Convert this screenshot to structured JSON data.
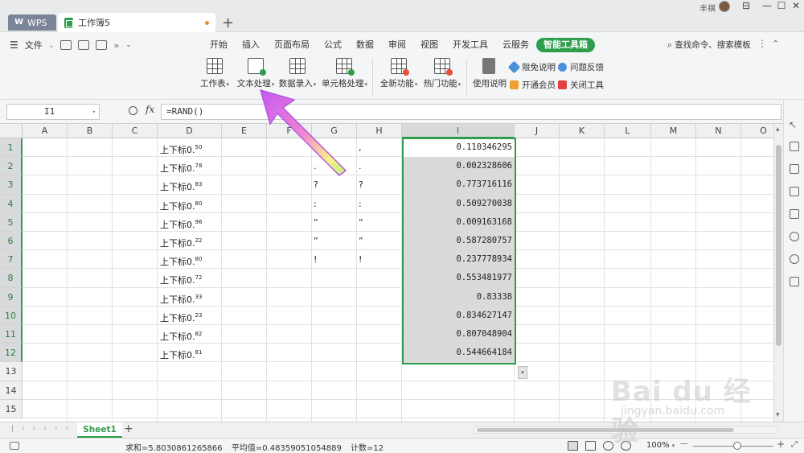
{
  "titlebar": {
    "home_tab": "WPS",
    "doc_tab": "工作簿5",
    "new_tab": "+",
    "user": "丰祺",
    "controls": [
      "⊟",
      "—",
      "☐",
      "✕"
    ]
  },
  "menubar": {
    "file": "文件",
    "tabs": [
      "开始",
      "插入",
      "页面布局",
      "公式",
      "数据",
      "审阅",
      "视图",
      "开发工具",
      "云服务",
      "智能工具箱"
    ],
    "active_tab": "智能工具箱",
    "search": "查找命令、搜索模板"
  },
  "ribbon": {
    "buttons": [
      "工作表",
      "文本处理",
      "数据录入",
      "单元格处理",
      "全新功能",
      "热门功能",
      "使用说明"
    ],
    "small": [
      "限免说明",
      "问题反馈",
      "开通会员",
      "关闭工具"
    ]
  },
  "formula": {
    "cell_ref": "I1",
    "fx": "fx",
    "value": "=RAND()"
  },
  "columns": [
    "A",
    "B",
    "C",
    "D",
    "E",
    "F",
    "G",
    "H",
    "I",
    "J",
    "K",
    "L",
    "M",
    "N",
    "O"
  ],
  "rows": [
    "1",
    "2",
    "3",
    "4",
    "5",
    "6",
    "7",
    "8",
    "9",
    "10",
    "11",
    "12",
    "13",
    "14",
    "15"
  ],
  "column_d": {
    "label": "上下标",
    "values": [
      "0.",
      "0.",
      "0.",
      "0.",
      "0.",
      "0.",
      "0.",
      "0.",
      "0.",
      "0.",
      "0.",
      "0."
    ],
    "sups": [
      "50",
      "78",
      "83",
      "80",
      "96",
      "22",
      "80",
      "72",
      "33",
      "23",
      "82",
      "81"
    ]
  },
  "column_g": [
    ",",
    ".",
    "?",
    ":",
    "“",
    "”",
    "!"
  ],
  "column_h": [
    ",",
    ".",
    "?",
    ":",
    "“",
    "”",
    "!"
  ],
  "column_i": [
    "0.110346295",
    "0.002328606",
    "0.773716116",
    "0.509270038",
    "0.009163168",
    "0.587280757",
    "0.237778934",
    "0.553481977",
    "0.83338",
    "0.834627147",
    "0.807048904",
    "0.544664184"
  ],
  "sheet_tabs": {
    "active": "Sheet1",
    "add": "+"
  },
  "status": {
    "sum": "求和=5.8030861265866",
    "average": "平均值=0.48359051054889",
    "count": "计数=12",
    "zoom": "100%",
    "minus": "—",
    "plus": "+"
  },
  "watermark": {
    "main": "Bai du 经验",
    "sub": "jingyan.baidu.com"
  },
  "colors": {
    "accent": "#2e9d4c",
    "selection": "#dadada"
  }
}
